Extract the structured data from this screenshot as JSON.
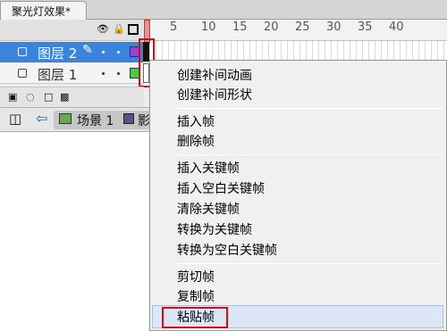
{
  "document": {
    "tab_title": "聚光灯效果*"
  },
  "timeline": {
    "frame_numbers": [
      "5",
      "10",
      "15",
      "20",
      "25",
      "30",
      "35",
      "40"
    ],
    "layers": [
      {
        "name": "图层 2",
        "selected": true,
        "color": "#9b3fd0"
      },
      {
        "name": "图层 1",
        "selected": false,
        "color": "#49c849"
      }
    ]
  },
  "editbar": {
    "scene_label": "场景 1",
    "next_label": "影"
  },
  "context_menu": {
    "items": [
      "创建补间动画",
      "创建补间形状",
      "插入帧",
      "删除帧",
      "插入关键帧",
      "插入空白关键帧",
      "清除关键帧",
      "转换为关键帧",
      "转换为空白关键帧",
      "剪切帧",
      "复制帧",
      "粘贴帧"
    ],
    "highlighted_item": "粘贴帧"
  },
  "colors": {
    "selection_blue": "#3b84de",
    "annotation_red": "#d01010"
  }
}
